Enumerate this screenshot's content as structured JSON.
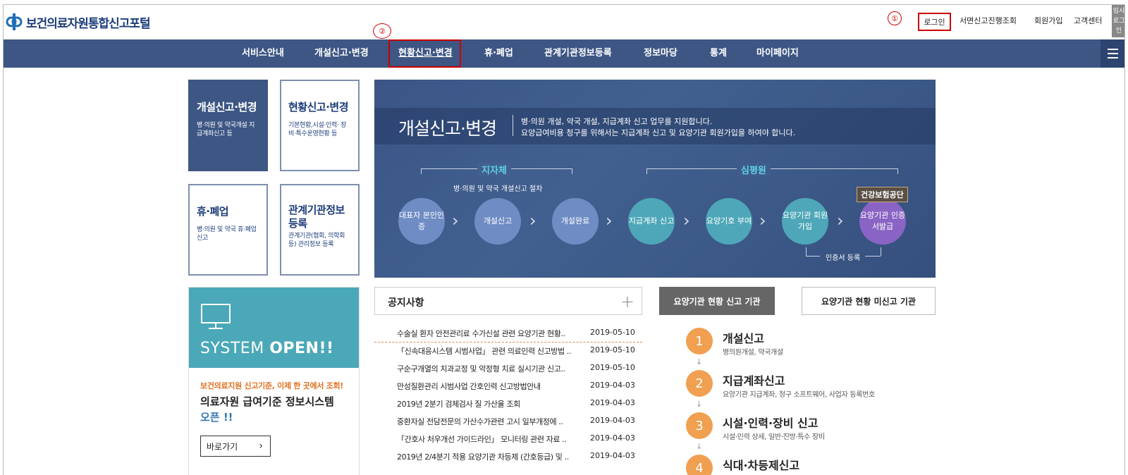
{
  "header": {
    "logo_text": "보건의료자원통합신고포털",
    "marker_1": "①",
    "login": "로그인",
    "paper_status": "서면신고진행조회",
    "signup": "회원가입",
    "support": "고객센터",
    "temp_login": "임시 로그인"
  },
  "nav": {
    "marker_2": "②",
    "items": [
      "서비스안내",
      "개설신고·변경",
      "현황신고·변경",
      "휴·폐업",
      "관계기관정보등록",
      "정보마당",
      "통계",
      "마이페이지"
    ]
  },
  "services": [
    {
      "title": "개설신고·변경",
      "desc": "병·의원 및 약국개설 지급계좌신고 등"
    },
    {
      "title": "현황신고·변경",
      "desc": "기본현황,시설·인력· 장비·특수운영현황 등"
    },
    {
      "title": "휴·폐업",
      "desc": "병·의원 및 약국 휴·폐업 신고"
    },
    {
      "title": "관계기관정보 등록",
      "desc": "관계기관(협회, 의학회 등) 관리정보 등록"
    }
  ],
  "banner": {
    "title": "개설신고·변경",
    "desc_line1": "병·의원 개설, 약국 개설, 지급계좌 신고 업무를 지원합니다.",
    "desc_line2": "요양급여비용 청구를 위해서는 지급계좌 신고 및 요양기관 회원가입을 하여야 합니다.",
    "group1": "지자체",
    "group2": "심평원",
    "sub_label": "병·의원 및 약국 개설신고 절차",
    "steps": [
      "대표자 본인인증",
      "개설신고",
      "개설완료",
      "지급계좌 신고",
      "요양기호 부여",
      "요양기관 회원가입",
      "요양기관 인증서발급"
    ],
    "nhis": "건강보험공단",
    "cert": "인증서 등록"
  },
  "system": {
    "open_prefix": "SYSTEM ",
    "open_bold": "OPEN!!",
    "orange_text": "보건의료지원 신고기준, 이제 한 곳에서 조회!",
    "main_line1": "의료자원 급여기준 정보시스템",
    "main_line2": "오픈 !!",
    "goto": "바로가기"
  },
  "notice": {
    "title": "공지사항",
    "items": [
      {
        "title": "수술실 환자 안전관리료 수가신설 관련 요양기관 현황..",
        "date": "2019-05-10"
      },
      {
        "title": "「신속대응시스템 시범사업」 관련 의료인력 신고방법 ..",
        "date": "2019-05-10"
      },
      {
        "title": "구순구개열의 치과교정 및 악정형 치료 실시기관 신고..",
        "date": "2019-05-10"
      },
      {
        "title": "만성질환관리 시범사업 간호인력 신고방법안내",
        "date": "2019-04-03"
      },
      {
        "title": "2019년 2분기 검체검사 질 가산율 조회",
        "date": "2019-04-03"
      },
      {
        "title": "중환자실 전담전문의 가산수가관련 고시 일부개정에 ..",
        "date": "2019-04-03"
      },
      {
        "title": "「간호사 처우개선 가이드라인」 모니터링 관련 자료 ..",
        "date": "2019-04-03"
      },
      {
        "title": "2019년 2/4분기 적용 요양기관 차등제 (간호등급) 및 ..",
        "date": "2019-04-03"
      }
    ]
  },
  "tabs": {
    "reported": "요양기관 현황 신고 기관",
    "unreported": "요양기관 현황 미신고 기관"
  },
  "ordered_steps": [
    {
      "num": "1",
      "title": "개설신고",
      "desc": "병의원개설, 약국개설"
    },
    {
      "num": "2",
      "title": "지급계좌신고",
      "desc": "요양기관 지급계좌, 청구 소프트웨어, 사업자 등록번호"
    },
    {
      "num": "3",
      "title": "시설·인력·장비 신고",
      "desc": "시설·인력 상세, 일반·진방·특수 장비"
    },
    {
      "num": "4",
      "title": "식대·차등제신고",
      "desc": ""
    }
  ],
  "down_arrow": "↓"
}
